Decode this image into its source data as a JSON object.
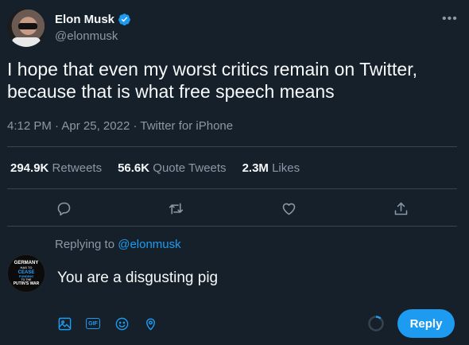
{
  "tweet": {
    "author": {
      "display_name": "Elon Musk",
      "handle": "@elonmusk",
      "verified": true
    },
    "text": "I hope that even my worst critics remain on Twitter, because that is what free speech means",
    "time": "4:12 PM",
    "date": "Apr 25, 2022",
    "source": "Twitter for iPhone",
    "separator": "·"
  },
  "stats": [
    {
      "value": "294.9K",
      "label": "Retweets"
    },
    {
      "value": "56.6K",
      "label": "Quote Tweets"
    },
    {
      "value": "2.3M",
      "label": "Likes"
    }
  ],
  "actions": [
    "reply-icon",
    "retweet-icon",
    "like-icon",
    "share-icon"
  ],
  "reply": {
    "replying_prefix": "Replying to",
    "replying_to": "@elonmusk",
    "avatar_text": [
      "GERMANY",
      "HAS TO",
      "CEASE",
      "FUNDING",
      "TO THE",
      "PUTIN'S WAR"
    ],
    "input_value": "You are a disgusting pig",
    "tools": [
      "image-icon",
      "gif-icon",
      "emoji-icon",
      "location-icon"
    ],
    "gif_label": "GIF",
    "button_label": "Reply"
  },
  "colors": {
    "background": "#15202b",
    "accent": "#1d9bf0",
    "secondary_text": "#8b98a5",
    "divider": "#38444d"
  }
}
